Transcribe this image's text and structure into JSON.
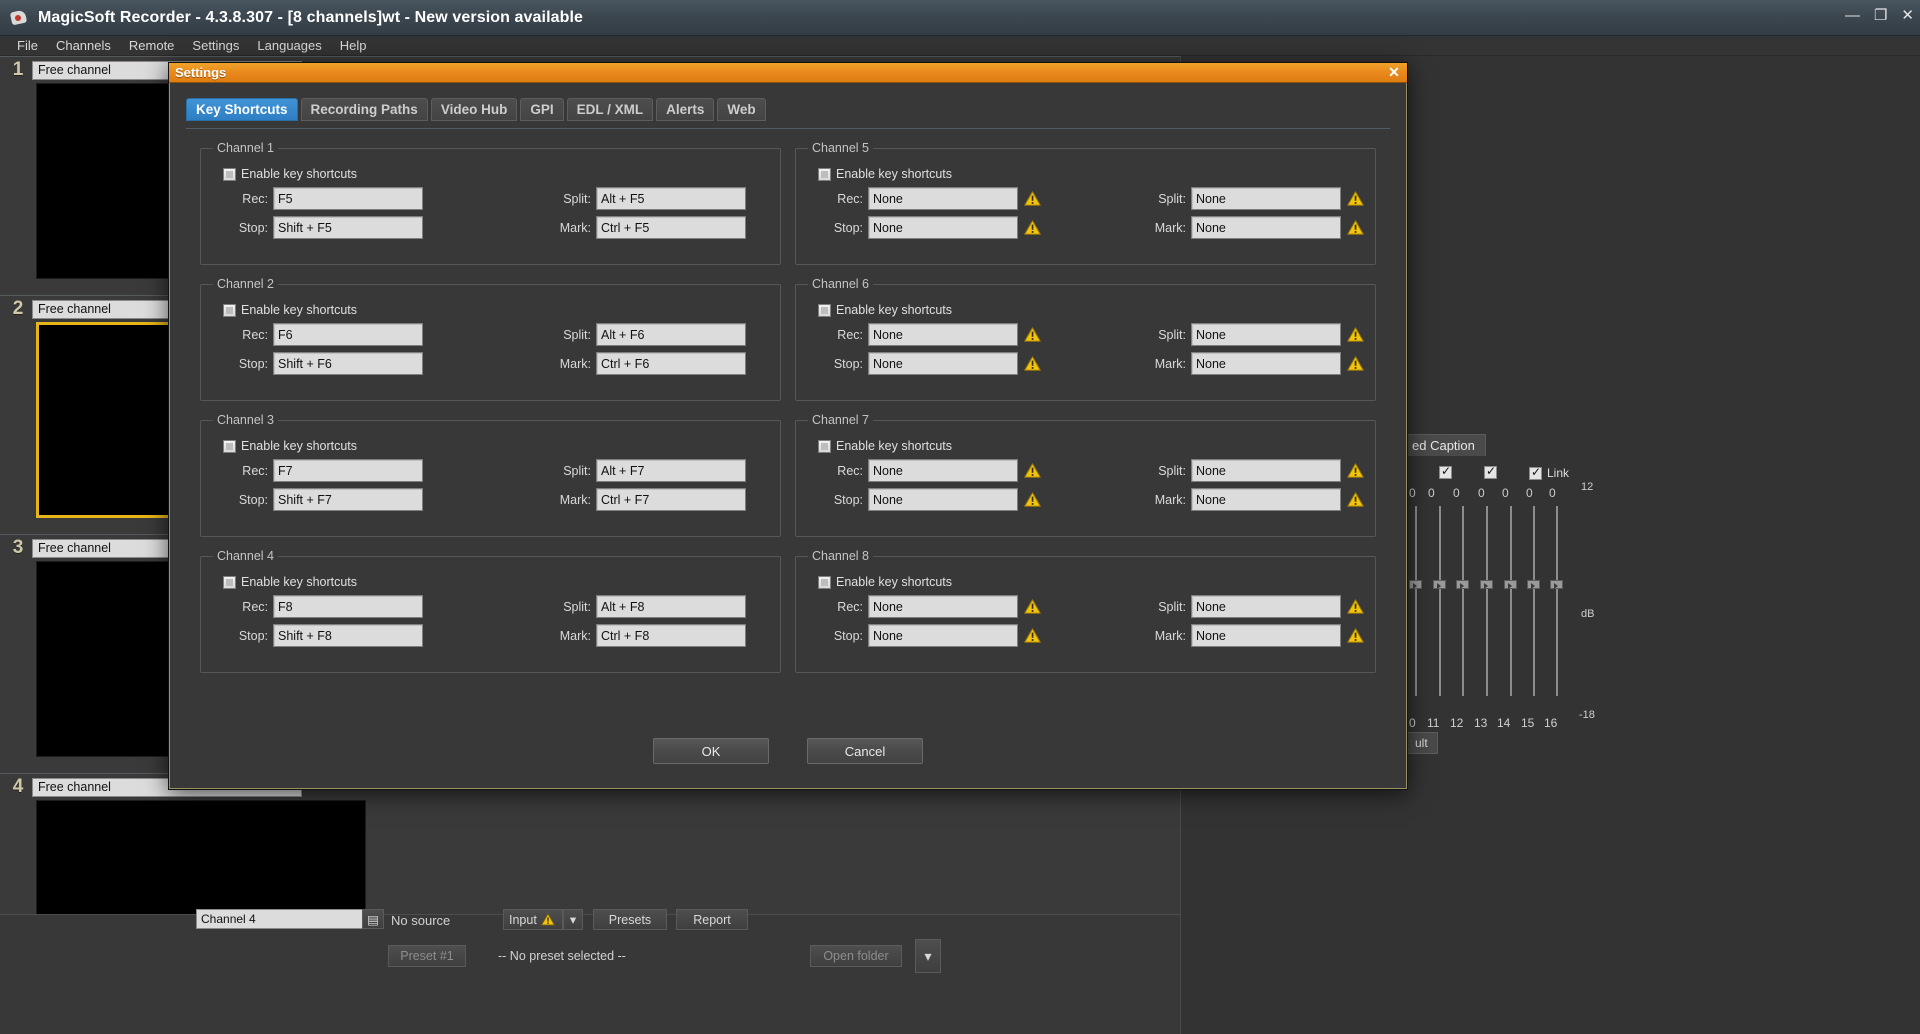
{
  "app": {
    "title": "MagicSoft Recorder - 4.3.8.307 - [8 channels]wt - New version available",
    "window_buttons": {
      "minimize": "—",
      "maximize": "❐",
      "close": "✕"
    },
    "menu": [
      "File",
      "Channels",
      "Remote",
      "Settings",
      "Languages",
      "Help"
    ],
    "channels": [
      {
        "number": "1",
        "name": "Free channel",
        "selected": false
      },
      {
        "number": "2",
        "name": "Free channel",
        "selected": true
      },
      {
        "number": "3",
        "name": "Free channel",
        "selected": false
      },
      {
        "number": "4",
        "name": "Free channel",
        "selected": false
      }
    ],
    "bottom": {
      "no_source": "No source",
      "input": "Input",
      "presets": "Presets",
      "report": "Report",
      "preset_button": "Preset #1",
      "preset_status": "-- No preset selected --",
      "open_folder": "Open folder",
      "channel_label": "Channel 4"
    },
    "cc_panel": {
      "title": "ed Caption",
      "link_label": "Link",
      "zeros": [
        "0",
        "0",
        "0",
        "0",
        "0",
        "0",
        "0"
      ],
      "scale_top": "12",
      "scale_bottom": "-18",
      "db": "dB",
      "fader_labels": [
        "0",
        "11",
        "12",
        "13",
        "14",
        "15",
        "16"
      ],
      "default_button": "ult"
    }
  },
  "dialog": {
    "title": "Settings",
    "close": "✕",
    "tabs": [
      {
        "label": "Key Shortcuts",
        "active": true
      },
      {
        "label": "Recording Paths",
        "active": false
      },
      {
        "label": "Video Hub",
        "active": false
      },
      {
        "label": "GPI",
        "active": false
      },
      {
        "label": "EDL / XML",
        "active": false
      },
      {
        "label": "Alerts",
        "active": false
      },
      {
        "label": "Web",
        "active": false
      }
    ],
    "enable_label": "Enable key shortcuts",
    "captions": {
      "rec": "Rec:",
      "stop": "Stop:",
      "split": "Split:",
      "mark": "Mark:"
    },
    "groups": [
      {
        "title": "Channel 1",
        "enabled": false,
        "rec": "F5",
        "split": "Alt + F5",
        "stop": "Shift + F5",
        "mark": "Ctrl + F5",
        "warn_rec": false,
        "warn_split": false,
        "warn_stop": false,
        "warn_mark": false
      },
      {
        "title": "Channel 5",
        "enabled": false,
        "rec": "None",
        "split": "None",
        "stop": "None",
        "mark": "None",
        "warn_rec": true,
        "warn_split": true,
        "warn_stop": true,
        "warn_mark": true
      },
      {
        "title": "Channel 2",
        "enabled": false,
        "rec": "F6",
        "split": "Alt + F6",
        "stop": "Shift + F6",
        "mark": "Ctrl + F6",
        "warn_rec": false,
        "warn_split": false,
        "warn_stop": false,
        "warn_mark": false
      },
      {
        "title": "Channel 6",
        "enabled": false,
        "rec": "None",
        "split": "None",
        "stop": "None",
        "mark": "None",
        "warn_rec": true,
        "warn_split": true,
        "warn_stop": true,
        "warn_mark": true
      },
      {
        "title": "Channel 3",
        "enabled": false,
        "rec": "F7",
        "split": "Alt + F7",
        "stop": "Shift + F7",
        "mark": "Ctrl + F7",
        "warn_rec": false,
        "warn_split": false,
        "warn_stop": false,
        "warn_mark": false
      },
      {
        "title": "Channel 7",
        "enabled": false,
        "rec": "None",
        "split": "None",
        "stop": "None",
        "mark": "None",
        "warn_rec": true,
        "warn_split": true,
        "warn_stop": true,
        "warn_mark": true
      },
      {
        "title": "Channel 4",
        "enabled": false,
        "rec": "F8",
        "split": "Alt + F8",
        "stop": "Shift + F8",
        "mark": "Ctrl + F8",
        "warn_rec": false,
        "warn_split": false,
        "warn_stop": false,
        "warn_mark": false
      },
      {
        "title": "Channel 8",
        "enabled": false,
        "rec": "None",
        "split": "None",
        "stop": "None",
        "mark": "None",
        "warn_rec": true,
        "warn_split": true,
        "warn_stop": true,
        "warn_mark": true
      }
    ],
    "ok": "OK",
    "cancel": "Cancel"
  },
  "colors": {
    "dialog_title_bar": "#e8871b",
    "tab_active": "#2f7fc4",
    "warning": "#f2c40c",
    "selection_border": "#e8b519",
    "field_bg": "#dcdcdc"
  }
}
